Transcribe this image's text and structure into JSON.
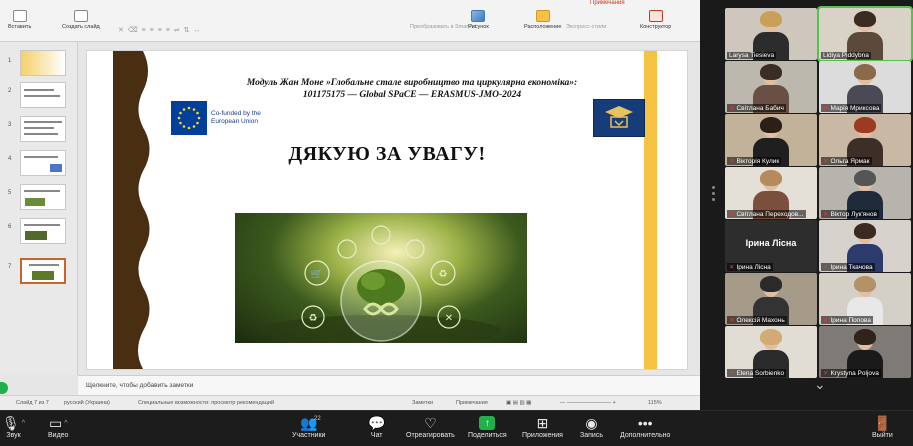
{
  "ribbon": {
    "paste_label": "Вставить",
    "new_slide_label": "Создать слайд",
    "convert_label": "Преобразовать в SmartArt",
    "picture_label": "Рисунок",
    "arrange_label": "Расположение",
    "express_label": "Экспресс-стили",
    "designer_label": "Конструктор",
    "ghost_tools": "✕ ⌫ ≡ ≡ ≡ ≡  ⇌ ⇅ ↔",
    "top_overflow": "Примечания"
  },
  "thumbnails": [
    {
      "num": "1"
    },
    {
      "num": "2"
    },
    {
      "num": "3"
    },
    {
      "num": "4"
    },
    {
      "num": "5"
    },
    {
      "num": "6"
    },
    {
      "num": "7"
    }
  ],
  "slide": {
    "header_line1": "Модуль Жан Моне »Глобальне сталe виробництво та циркулярна економіка»:",
    "header_line2": "101175175 — Global SPaCE — ERASMUS-JMO-2024",
    "eu_text_line1": "Co-funded by the",
    "eu_text_line2": "European Union",
    "title": "ДЯКУЮ ЗА УВАГУ!"
  },
  "notes": {
    "placeholder": "Щелкните, чтобы добавить заметки"
  },
  "statusbar": {
    "slide_info": "Слайд 7 из 7",
    "language": "русский (Украина)",
    "accessibility": "Специальные возможности: просмотр рекомендаций",
    "notes_btn": "Заметки",
    "comments_btn": "Примечания",
    "zoom": "115%"
  },
  "participants": [
    {
      "name": "Larysa Tiesieva",
      "muted": false,
      "speaking": false,
      "bg": "#cfc7bd",
      "hair": "#c9a05a",
      "shirt": "#2c2c2c"
    },
    {
      "name": "Lidiya Piddybna",
      "muted": false,
      "speaking": true,
      "bg": "#d9d2c6",
      "hair": "#3b2b20",
      "shirt": "#5b4a3a"
    },
    {
      "name": "Світлана Бабич",
      "muted": true,
      "speaking": false,
      "bg": "#bdb8ae",
      "hair": "#3a2d26",
      "shirt": "#6a5044"
    },
    {
      "name": "Марія Мриксова",
      "muted": true,
      "speaking": false,
      "bg": "#dcdcdc",
      "hair": "#8a6a48",
      "shirt": "#4a4a55"
    },
    {
      "name": "Вікторія Кулик",
      "muted": true,
      "speaking": false,
      "bg": "#c2b29a",
      "hair": "#2b1f18",
      "shirt": "#1f1f1f"
    },
    {
      "name": "Ольга Ярмак",
      "muted": true,
      "speaking": false,
      "bg": "#c9b8a3",
      "hair": "#9d3a22",
      "shirt": "#3d2e28"
    },
    {
      "name": "Світлана Переходов...",
      "muted": true,
      "speaking": false,
      "bg": "#e4e0d8",
      "hair": "#b58a5c",
      "shirt": "#7a4f3c"
    },
    {
      "name": "Віктор Лук'янов",
      "muted": true,
      "speaking": false,
      "bg": "#b7b4ae",
      "hair": "#555",
      "shirt": "#1f2a3a"
    },
    {
      "name": "Ірина Лісна",
      "muted": true,
      "speaking": false,
      "bg": "#2d2d2d",
      "name_only": true
    },
    {
      "name": "Ірина Ткачова",
      "muted": true,
      "speaking": false,
      "bg": "#d7d3cc",
      "hair": "#3a2a20",
      "shirt": "#2c3b6b"
    },
    {
      "name": "Олексій Махонь",
      "muted": true,
      "speaking": false,
      "bg": "#a69a88",
      "hair": "#2a2a2a",
      "shirt": "#333"
    },
    {
      "name": "Ірина Попова",
      "muted": true,
      "speaking": false,
      "bg": "#d5d0c7",
      "hair": "#b39268",
      "shirt": "#e8e8e8"
    },
    {
      "name": "Elena Sorbienko",
      "muted": true,
      "speaking": false,
      "bg": "#e1dcd4",
      "hair": "#d2ab74",
      "shirt": "#2a2a2a"
    },
    {
      "name": "Krystyna Poljova",
      "muted": true,
      "speaking": false,
      "bg": "#7e7a76",
      "hair": "#2f231c",
      "shirt": "#1a1a1a"
    }
  ],
  "toolbar": {
    "audio_label": "Звук",
    "video_label": "Видео",
    "participants_label": "Участники",
    "participants_count": "22",
    "chat_label": "Чат",
    "react_label": "Отреагировать",
    "share_label": "Поделиться",
    "apps_label": "Приложения",
    "record_label": "Запись",
    "more_label": "Дополнительно",
    "leave_label": "Выйти"
  },
  "colors": {
    "accent_orange": "#c8632a",
    "slide_gold": "#f5c242",
    "eu_blue": "#003f9b",
    "zoom_green": "#21b04b",
    "mute_red": "#e03b3b"
  }
}
